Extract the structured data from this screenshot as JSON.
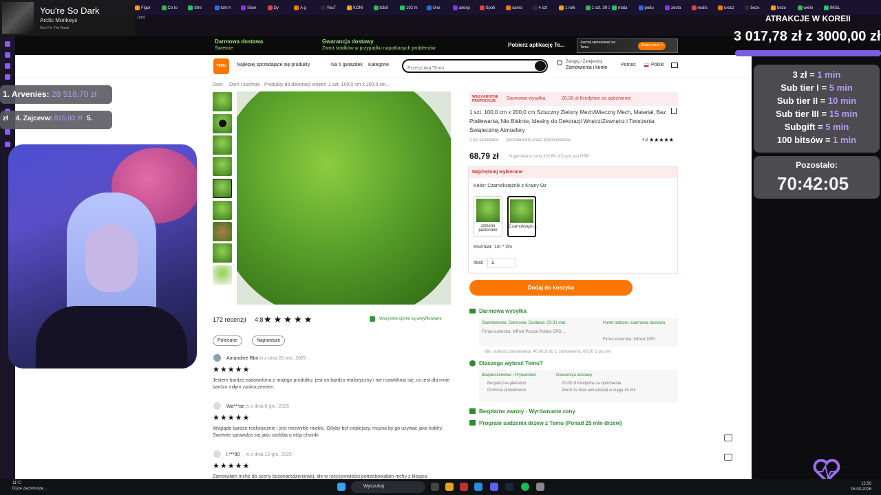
{
  "now_playing": {
    "title": "You're So Dark",
    "artist": "Arctic Monkeys",
    "album": "One For The Road"
  },
  "browser": {
    "address_fragment": ".html",
    "tabs": [
      "Figur",
      "Co to",
      "Stre",
      "tom h",
      "Slow",
      "Dy",
      "A g",
      "YouT",
      "KONI",
      "b3cll",
      "102 m",
      "Uroi",
      "aliexp",
      "Spoti",
      "samo",
      "4 szt",
      "1 rolk",
      "1 szt. 39 3",
      "mata",
      "podu",
      "zesta",
      "realis",
      "urocz",
      "bezo",
      "bezo",
      "wielo",
      "IMGL"
    ]
  },
  "promo": {
    "free_delivery_title": "Darmowa dostawa",
    "free_delivery_sub": "Świetnie",
    "guarantee_title": "Gwarancja dostawy",
    "guarantee_sub": "Zwrot środków w przypadku napotkanych problemów",
    "app_download": "Pobierz aplikację Te...",
    "seller_cta": "Zacznij sprzedawać na Temu",
    "join_button": "Dołącz teraz >"
  },
  "nav": {
    "bestsellers": "Najlepiej sprzedające się produkty",
    "five_stars": "Na 5 gwiazdek",
    "categories": "Kategorie",
    "search_placeholder": "Przeszukaj Temu",
    "login": "Zaloguj / Zarejestruj",
    "orders": "Zamówienia i konto",
    "help": "Pomoc",
    "language": "Polski"
  },
  "breadcrumb": [
    "Dom",
    "Dom i kuchnia",
    "Produkty do dekoracji wnętrz",
    "1 szt. 100,0 cm x 200,0 cm..."
  ],
  "product": {
    "badge": "WIELKANOCNE PROPOZYCJE",
    "free_shipping_badge": "Darmowa wysyłka",
    "credit_badge": "20,00 zł Kredytów za opóźnienie",
    "title_line1": "1 szt. 100,0 cm x 200,0 cm Sztuczny Zielony Mech/Wieczny Mech, Materiał, Bez",
    "title_line2": "Podłewania, Nie Blaknie, Idealny do Dekoracji Wnętrz/Zewnętrz i Tworzenia",
    "title_line3": "Świątecznej Atmosfery",
    "sold": "2 tys sprzedane",
    "seller": "Sprzedawane przez przedsiębiorcę",
    "rating": "4,8",
    "price": "68,79 zł",
    "rrp": "Sugerowana cena 332,66 zł Czym jest RRP",
    "choice_header": "Najchętniej wybierane",
    "color_label": "Kolor: Czarnoksiężnik z Krainy Oz",
    "color_options": [
      "szmerie pasterskie",
      "Czarnoksiężn..."
    ],
    "size_label": "Rozmiar: 1m * 2m",
    "qty_label": "Ilość",
    "qty_value": "1",
    "add_to_cart": "Dodaj do koszyka"
  },
  "reviews": {
    "count": "172 recenzji",
    "rating": "4,8",
    "verified": "Wszystkie opinie są weryfikowane",
    "filter_recommended": "Polecane",
    "filter_newest": "Najnowsze",
    "items": [
      {
        "name": "Amandine Rbn",
        "date": "w z dnia 26 wrz. 2025",
        "stars": "★★★★★",
        "text1": "Jestem bardzo zadowolona z mojego produktu: jest on bardzo realistyczny i nie rozwłóknia się, co jest dla mnie",
        "text2": "bardzo miłym zaskoczeniem."
      },
      {
        "name": "Wa***ae",
        "date": "w z dnia 8 gru. 2025",
        "stars": "★★★★★",
        "text1": "Wygląda bardzo realistycznie i jest niezwykle miękki. Gdyby był cieplejszy, można by go używać jako kołdry.",
        "text2": "Świetnie sprawdza się jako ozdoba u stóp choinki"
      },
      {
        "name": "l.***90",
        "date": "w z dnia 12 gru. 2025",
        "stars": "★★★★★",
        "text1": "Zamówiłam mchę do sceny bożonarodzeniowej, ale w rzeczywistości potrzebowałam mchy z klejąca",
        "text2": ""
      }
    ]
  },
  "shipping": {
    "heading": "Darmowa wysyłka",
    "standard": "Standardowa: Darmowa. Dostawa: 23-31 mar.",
    "couriers": "Firma kurierska: InPost Poczta Polska DPD ...",
    "pickup": "Punkt odbioru: Darmowa dostawa",
    "pickup_couriers": "Firma kurierska: InPost DPD",
    "minimum": "Min. wartość zamówienia: 40,00 zł do 1. zamówienia, 60,00 zł po nim"
  },
  "why": {
    "heading": "Dlaczego wybrać Temu?",
    "security_title": "Bezpieczeństwo i Prywatność",
    "security_1": "Bezpieczne płatności",
    "security_2": "Ochrona prywatności",
    "guarantee_title": "Gwarancja dostawy",
    "guarantee_1": "20,00 zł Kredytów za opóźnienie",
    "guarantee_2": "Zwrot za brak aktualizacji w ciągu 15 dni"
  },
  "returns": "Bezpłatne zwroty · Wyrównanie ceny",
  "trees": "Program sadzenia drzew z Temu (Ponad 25 mln drzew)",
  "overlay": {
    "goal_title": "ATRAKCJE W KOREII",
    "goal_amount": "3 017,78 zł z 3000,00 zł",
    "goal_progress": 1.0,
    "rates": [
      {
        "k": "3 zł =",
        "v": "1 min"
      },
      {
        "k": "Sub tier I =",
        "v": "5 min"
      },
      {
        "k": "Sub tier II =",
        "v": "10 min"
      },
      {
        "k": "Sub tier III =",
        "v": "15 min"
      },
      {
        "k": "Subgift =",
        "v": "5 min"
      },
      {
        "k": "100 bitsów =",
        "v": "1 min"
      }
    ],
    "timer_label": "Pozostało:",
    "timer_value": "70:42:05",
    "leader1_name": "1. Arvenies:",
    "leader1_amount": "28 518,70 zł",
    "leader4_prefix": "zł",
    "leader4_name": "4. Zajcevw:",
    "leader4_amount": "815,00 zł",
    "leader5": "5."
  },
  "taskbar": {
    "weather_temp": "11°C",
    "weather_desc": "Duże zachmurze...",
    "search": "Wyszukaj",
    "time": "12:50",
    "date": "16.03.2026"
  }
}
